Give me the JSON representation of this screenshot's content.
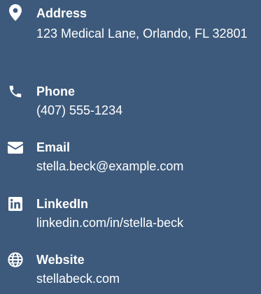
{
  "contact": {
    "address": {
      "label": "Address",
      "value": "123 Medical Lane, Orlando, FL 32801",
      "icon": "map-pin-icon"
    },
    "phone": {
      "label": "Phone",
      "value": "(407) 555-1234",
      "icon": "phone-icon"
    },
    "email": {
      "label": "Email",
      "value": "stella.beck@example.com",
      "icon": "envelope-icon"
    },
    "linkedin": {
      "label": "LinkedIn",
      "value": "linkedin.com/in/stella-beck",
      "icon": "linkedin-icon"
    },
    "website": {
      "label": "Website",
      "value": "stellabeck.com",
      "icon": "globe-icon"
    }
  },
  "colors": {
    "background": "#3d5a7c",
    "text": "#ffffff"
  }
}
